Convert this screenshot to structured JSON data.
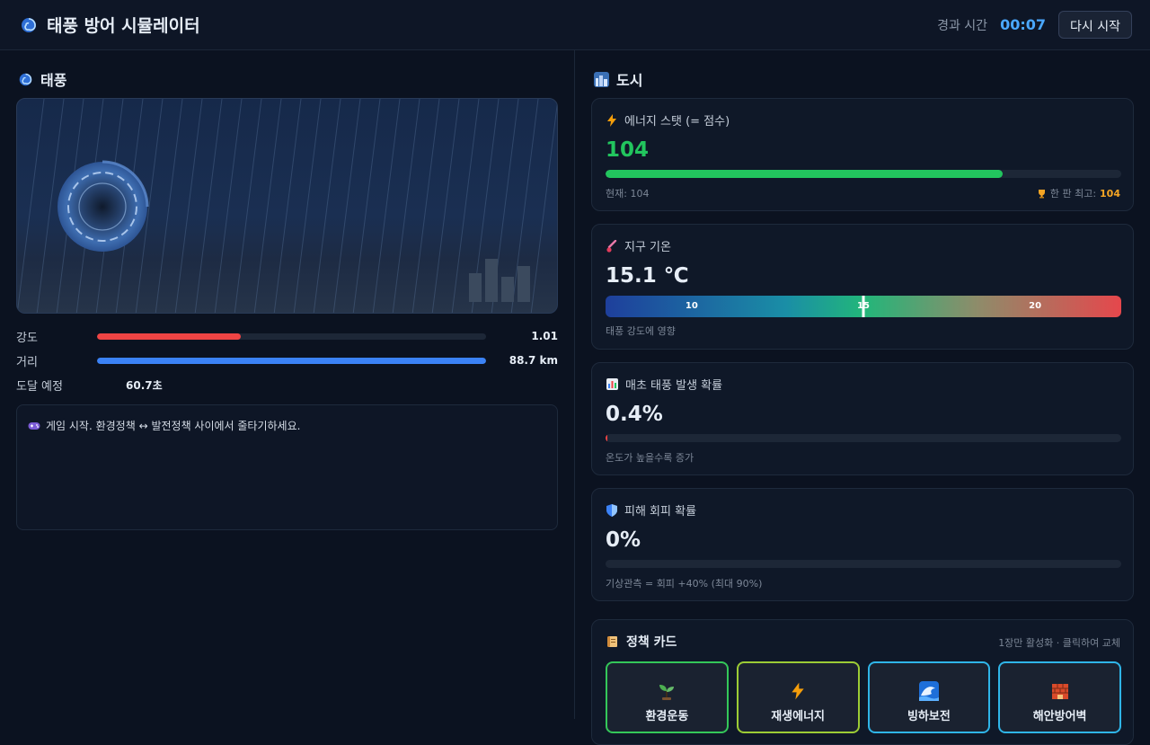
{
  "header": {
    "title": "태풍 방어 시뮬레이터",
    "elapsed_label": "경과 시간",
    "elapsed_value": "00:07",
    "restart_label": "다시 시작"
  },
  "typhoon": {
    "section_title": "태풍",
    "intensity_label": "강도",
    "intensity_value": "1.01",
    "intensity_fill": 0.37,
    "distance_label": "거리",
    "distance_value": "88.7 km",
    "distance_fill": 1.0,
    "eta_label": "도달 예정",
    "eta_value": "60.7초",
    "log": "게임 시작. 환경정책 ↔ 발전정책 사이에서 줄타기하세요."
  },
  "city": {
    "section_title": "도시",
    "energy": {
      "title": "에너지 스탯 (= 점수)",
      "value": "104",
      "fill": 0.77,
      "current": "현재: 104",
      "best_label": "한 판 최고:",
      "best_value": "104"
    },
    "temperature": {
      "title": "지구 기온",
      "value": "15.1 ℃",
      "ticks": [
        "10",
        "15",
        "20"
      ],
      "marker_fraction": 0.5,
      "note": "태풍 강도에 영향"
    },
    "probability": {
      "title": "매초 태풍 발생 확률",
      "value": "0.4%",
      "fill": 0.004,
      "note": "온도가 높을수록 증가"
    },
    "evasion": {
      "title": "피해 회피 확률",
      "value": "0%",
      "fill": 0,
      "note": "기상관측 = 회피 +40% (최대 90%)"
    }
  },
  "policy": {
    "title": "정책 카드",
    "hint": "1장만 활성화 · 클릭하여 교체",
    "cards": [
      {
        "label": "환경운동",
        "icon": "seedling-icon",
        "border": "#34c759"
      },
      {
        "label": "재생에너지",
        "icon": "lightning-icon",
        "border": "#9ccc35"
      },
      {
        "label": "빙하보전",
        "icon": "wave-icon",
        "border": "#2fb5e8"
      },
      {
        "label": "해안방어벽",
        "icon": "wall-icon",
        "border": "#2fb5e8"
      }
    ]
  },
  "colors": {
    "intensity": "#ef4444",
    "distance": "#3b82f6",
    "energy": "#22c55e",
    "accent": "#4aa8ff",
    "best": "#f5a524",
    "probability": "#ef4444"
  }
}
